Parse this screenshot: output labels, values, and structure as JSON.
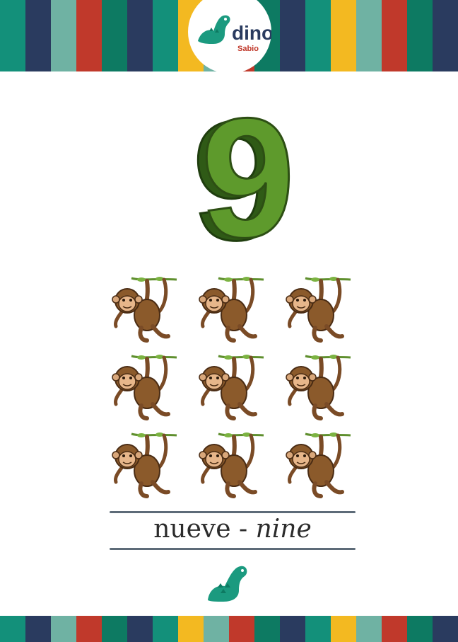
{
  "brand": {
    "logo_word": "dino",
    "logo_sub": "Sabio",
    "colors": {
      "teal": "#13907a",
      "navy": "#2a3b5f",
      "sage": "#6fb2a3",
      "red": "#c0392b",
      "darkgreen": "#0d7a62",
      "yellow": "#f3b921",
      "dino": "#1b9a7f"
    }
  },
  "stripe_colors": [
    "#13907a",
    "#2a3b5f",
    "#6fb2a3",
    "#c0392b",
    "#0d7a62",
    "#2a3b5f",
    "#13907a",
    "#f3b921",
    "#6fb2a3",
    "#c0392b",
    "#0d7a62",
    "#2a3b5f",
    "#13907a",
    "#f3b921",
    "#6fb2a3",
    "#c0392b",
    "#0d7a62",
    "#2a3b5f"
  ],
  "card": {
    "numeral": "9",
    "numeral_color": "#5e9a2c",
    "object_icon": "monkey-icon",
    "object_count": 9,
    "word_es": "nueve",
    "separator": " - ",
    "word_en": "nine"
  }
}
